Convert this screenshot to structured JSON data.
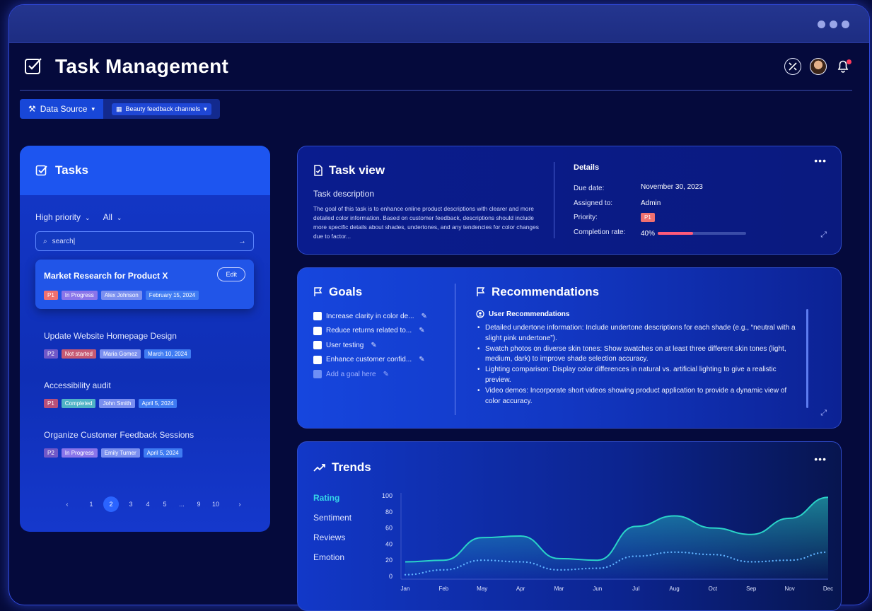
{
  "app": {
    "title": "Task Management"
  },
  "toolbar": {
    "data_source_label": "Data Source",
    "channel_label": "Beauty feedback channels"
  },
  "tasks_panel": {
    "title": "Tasks",
    "filter_priority": "High priority",
    "filter_scope": "All",
    "search_value": "search",
    "edit_label": "Edit",
    "items": [
      {
        "title": "Market Research for Product X",
        "priority": "P1",
        "status": "In Progress",
        "assignee": "Alex Johnson",
        "date": "February 15, 2024"
      },
      {
        "title": "Update Website Homepage Design",
        "priority": "P2",
        "status": "Not started",
        "assignee": "Maria Gomez",
        "date": "March 10, 2024"
      },
      {
        "title": "Accessibility audit",
        "priority": "P1",
        "status": "Completed",
        "assignee": "John Smith",
        "date": "April 5, 2024"
      },
      {
        "title": "Organize Customer Feedback Sessions",
        "priority": "P2",
        "status": "In Progress",
        "assignee": "Emily Turner",
        "date": "April 5, 2024"
      }
    ],
    "pagination": {
      "prev": "‹",
      "pages": [
        "1",
        "2",
        "3",
        "4",
        "5",
        "...",
        "9",
        "10"
      ],
      "current": "2",
      "next": "›"
    }
  },
  "task_view": {
    "title": "Task view",
    "description_label": "Task description",
    "description": "The goal of this task is to enhance online product descriptions with clearer and more detailed color information. Based on customer feedback, descriptions should include more specific details about shades, undertones, and any tendencies for color changes due to factor...",
    "details": {
      "heading": "Details",
      "due_label": "Due date:",
      "due_value": "November 30, 2023",
      "assigned_label": "Assigned to:",
      "assigned_value": "Admin",
      "priority_label": "Priority:",
      "priority_value": "P1",
      "completion_label": "Completion rate:",
      "completion_value": "40%",
      "completion_fraction": 0.4
    }
  },
  "goals": {
    "title": "Goals",
    "items": [
      "Increase clarity in color de...",
      "Reduce returns related to...",
      "User testing",
      "Enhance customer confid..."
    ],
    "add_placeholder": "Add a goal here"
  },
  "recommendations": {
    "title": "Recommendations",
    "subtitle": "User Recommendations",
    "items": [
      "Detailed undertone information: Include undertone descriptions for each shade (e.g., “neutral with a slight pink undertone”).",
      "Swatch photos on diverse skin tones: Show swatches on at least three different skin tones (light, medium, dark) to improve shade selection accuracy.",
      "Lighting comparison: Display color differences in natural vs. artificial lighting to give a realistic preview.",
      "Video demos: Incorporate short videos showing product application to provide a dynamic view of color accuracy."
    ]
  },
  "trends": {
    "title": "Trends",
    "metrics": [
      "Rating",
      "Sentiment",
      "Reviews",
      "Emotion"
    ],
    "active_metric": "Rating"
  },
  "chart_data": {
    "type": "area",
    "categories": [
      "Jan",
      "Feb",
      "May",
      "Apr",
      "Mar",
      "Jun",
      "Jul",
      "Aug",
      "Oct",
      "Sep",
      "Nov",
      "Dec"
    ],
    "ylim": [
      0,
      100
    ],
    "yticks": [
      "100",
      "80",
      "60",
      "40",
      "20",
      "0"
    ],
    "series": [
      {
        "values": [
          18,
          20,
          48,
          50,
          22,
          20,
          62,
          75,
          60,
          52,
          72,
          98
        ]
      },
      {
        "values": [
          2,
          8,
          20,
          18,
          8,
          10,
          25,
          30,
          27,
          18,
          20,
          30
        ]
      }
    ],
    "colors": {
      "primary": "#2ad3c8",
      "secondary": "#5fb2ff"
    }
  }
}
